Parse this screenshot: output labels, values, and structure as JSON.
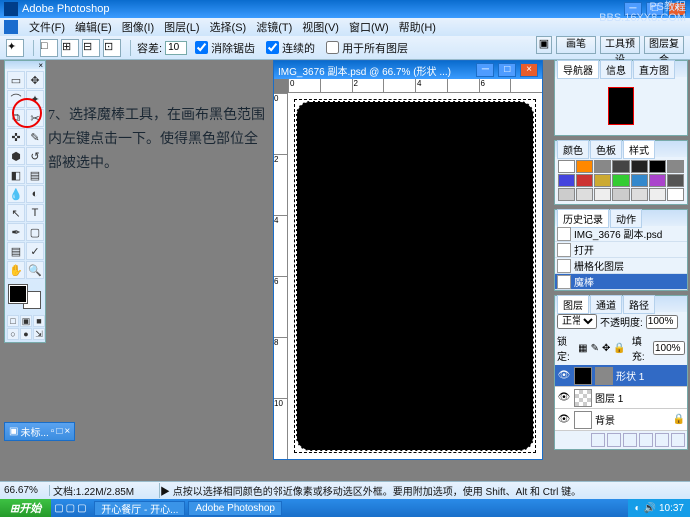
{
  "app": {
    "title": "Adobe Photoshop"
  },
  "watermark": {
    "line1": "PS教程",
    "line2": "BBS.16XX8.COM"
  },
  "menu": {
    "items": [
      "文件(F)",
      "编辑(E)",
      "图像(I)",
      "图层(L)",
      "选择(S)",
      "滤镜(T)",
      "视图(V)",
      "窗口(W)",
      "帮助(H)"
    ]
  },
  "options": {
    "tolerance_label": "容差:",
    "tolerance_value": "10",
    "antialias": "消除锯齿",
    "contiguous": "连续的",
    "all_layers": "用于所有图层"
  },
  "right_buttons": [
    "画笔",
    "工具预设",
    "图层复合"
  ],
  "instruction": {
    "text": "7、选择魔棒工具，在画布黑色范围内左键点击一下。使得黑色部位全部被选中。"
  },
  "document": {
    "title": "IMG_3676 副本.psd @ 66.7% (形状 ...)",
    "ruler_marks_h": [
      "0",
      "",
      "2",
      "",
      "4",
      "",
      "6",
      ""
    ],
    "ruler_marks_v": [
      "0",
      "2",
      "4",
      "6",
      "8",
      "10"
    ]
  },
  "navigator": {
    "tabs": [
      "导航器",
      "信息",
      "直方图"
    ]
  },
  "styles": {
    "tabs": [
      "颜色",
      "色板",
      "样式"
    ],
    "swatches": [
      "#fff",
      "#f80",
      "#888",
      "#444",
      "#222",
      "#000",
      "#888",
      "#44d",
      "#c33",
      "#ca3",
      "#3c3",
      "#38c",
      "#a4c",
      "#555",
      "#ccc",
      "#ddd",
      "#eee",
      "#ccc",
      "#ddd",
      "#eee",
      "#fff"
    ]
  },
  "history": {
    "tabs": [
      "历史记录",
      "动作"
    ],
    "source": "IMG_3676 副本.psd",
    "items": [
      "打开",
      "栅格化图层",
      "魔棒"
    ]
  },
  "layers": {
    "tabs": [
      "图层",
      "通道",
      "路径"
    ],
    "mode": "正常",
    "opacity_label": "不透明度:",
    "opacity": "100%",
    "lock_label": "锁定:",
    "fill_label": "填充:",
    "fill": "100%",
    "items": [
      "形状 1",
      "图层 1",
      "背景"
    ]
  },
  "status": {
    "zoom": "66.67%",
    "doc": "文档:1.22M/2.85M",
    "hint": "▶ 点按以选择相同颜色的邻近像素或移动选区外框。要用附加选项，使用 Shift、Alt 和 Ctrl 键。"
  },
  "minidoc": {
    "label": "未标..."
  },
  "taskbar": {
    "start": "开始",
    "tasks": [
      "开心餐厅 - 开心...",
      "Adobe Photoshop"
    ],
    "time": "10:37"
  }
}
